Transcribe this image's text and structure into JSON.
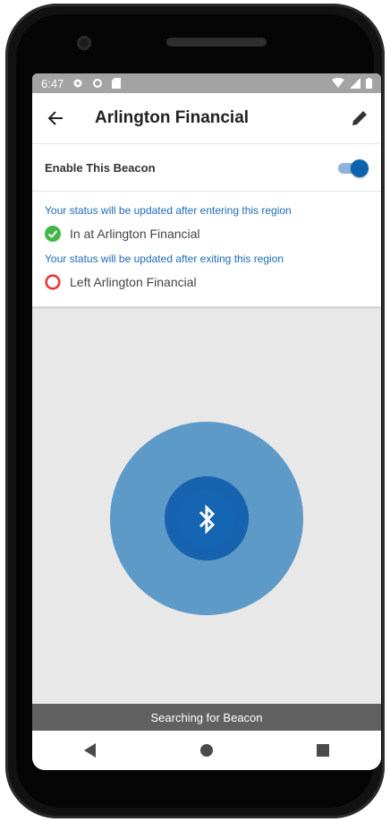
{
  "status_bar": {
    "time": "6:47",
    "icons": [
      "settings-icon",
      "circle-icon",
      "sd-card-icon",
      "wifi-icon",
      "signal-icon",
      "battery-icon"
    ]
  },
  "app_bar": {
    "title": "Arlington Financial",
    "back_icon": "arrow-back-icon",
    "edit_icon": "pencil-icon"
  },
  "beacon": {
    "enable_label": "Enable This Beacon",
    "enabled": true
  },
  "region": {
    "enter_hint": "Your status will be updated after entering this region",
    "enter_status": "In at Arlington Financial",
    "exit_hint": "Your status will be updated after exiting this region",
    "exit_status": "Left Arlington Financial"
  },
  "scan": {
    "icon": "bluetooth-icon",
    "message": "Searching for Beacon"
  },
  "colors": {
    "accent": "#1565b3",
    "hint_text": "#1d6bb7",
    "check_green": "#43b649",
    "exit_red": "#e53935",
    "scan_outer": "#5e9ac8"
  },
  "nav_bar": [
    "back-triangle-icon",
    "home-circle-icon",
    "recents-square-icon"
  ]
}
